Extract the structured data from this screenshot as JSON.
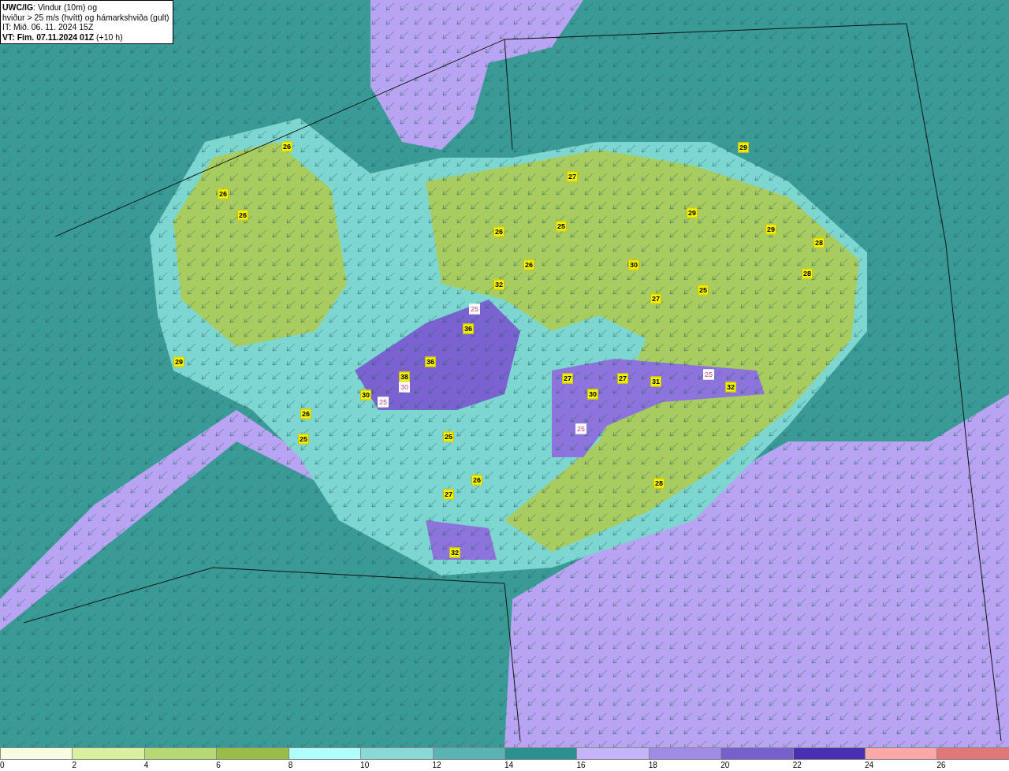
{
  "title_box": {
    "lines": [
      "**UWC/IG**: Vindur (10m) og",
      "hviður > 25 m/s (hvítt) og hámarkshviða (gult)",
      "IT: Mið. 06. 11. 2024 15Z",
      "**VT: Fim. 07.11.2024 01Z** (+10 h)"
    ]
  },
  "map_labels": [
    {
      "kind": "gust",
      "text": "26"
    },
    {
      "kind": "gust",
      "text": "26"
    },
    {
      "kind": "gust",
      "text": "26"
    },
    {
      "kind": "gust",
      "text": "29"
    },
    {
      "kind": "gust",
      "text": "27"
    },
    {
      "kind": "gust",
      "text": "29"
    },
    {
      "kind": "gust",
      "text": "26"
    },
    {
      "kind": "gust",
      "text": "25"
    },
    {
      "kind": "gust",
      "text": "29"
    },
    {
      "kind": "gust",
      "text": "28"
    },
    {
      "kind": "gust",
      "text": "26"
    },
    {
      "kind": "gust",
      "text": "32"
    },
    {
      "kind": "gust",
      "text": "28"
    },
    {
      "kind": "gust",
      "text": "30"
    },
    {
      "kind": "gust",
      "text": "27"
    },
    {
      "kind": "gust",
      "text": "25"
    },
    {
      "kind": "gust",
      "text": "36"
    },
    {
      "kind": "gust",
      "text": "29"
    },
    {
      "kind": "gust",
      "text": "38"
    },
    {
      "kind": "gust",
      "text": "36"
    },
    {
      "kind": "gust",
      "text": "30"
    },
    {
      "kind": "gust",
      "text": "27"
    },
    {
      "kind": "gust",
      "text": "30"
    },
    {
      "kind": "gust",
      "text": "27"
    },
    {
      "kind": "gust",
      "text": "31"
    },
    {
      "kind": "gust",
      "text": "32"
    },
    {
      "kind": "gust",
      "text": "26"
    },
    {
      "kind": "gust",
      "text": "25"
    },
    {
      "kind": "gust",
      "text": "25"
    },
    {
      "kind": "gust",
      "text": "26"
    },
    {
      "kind": "gust",
      "text": "27"
    },
    {
      "kind": "gust",
      "text": "28"
    },
    {
      "kind": "gust",
      "text": "32"
    },
    {
      "kind": "contour",
      "text": "25"
    },
    {
      "kind": "contour",
      "text": "30"
    },
    {
      "kind": "contour",
      "text": "25"
    },
    {
      "kind": "contour",
      "text": "25"
    },
    {
      "kind": "contour",
      "text": "25"
    }
  ],
  "legend": {
    "swatches": [
      {
        "color": "#f7fde0"
      },
      {
        "color": "#d8f0a0"
      },
      {
        "color": "#b5d975"
      },
      {
        "color": "#98bd48"
      },
      {
        "color": "#b0fffc"
      },
      {
        "color": "#8ad8d8"
      },
      {
        "color": "#5ab4b4"
      },
      {
        "color": "#2c9090"
      },
      {
        "color": "#c4b4fa"
      },
      {
        "color": "#a08ce6"
      },
      {
        "color": "#7860cc"
      },
      {
        "color": "#4830b0"
      },
      {
        "color": "#fca8a8"
      },
      {
        "color": "#e07878"
      }
    ],
    "ticks": [
      "0",
      "2",
      "4",
      "6",
      "8",
      "10",
      "12",
      "14",
      "16",
      "18",
      "20",
      "22",
      "24",
      "26"
    ]
  }
}
